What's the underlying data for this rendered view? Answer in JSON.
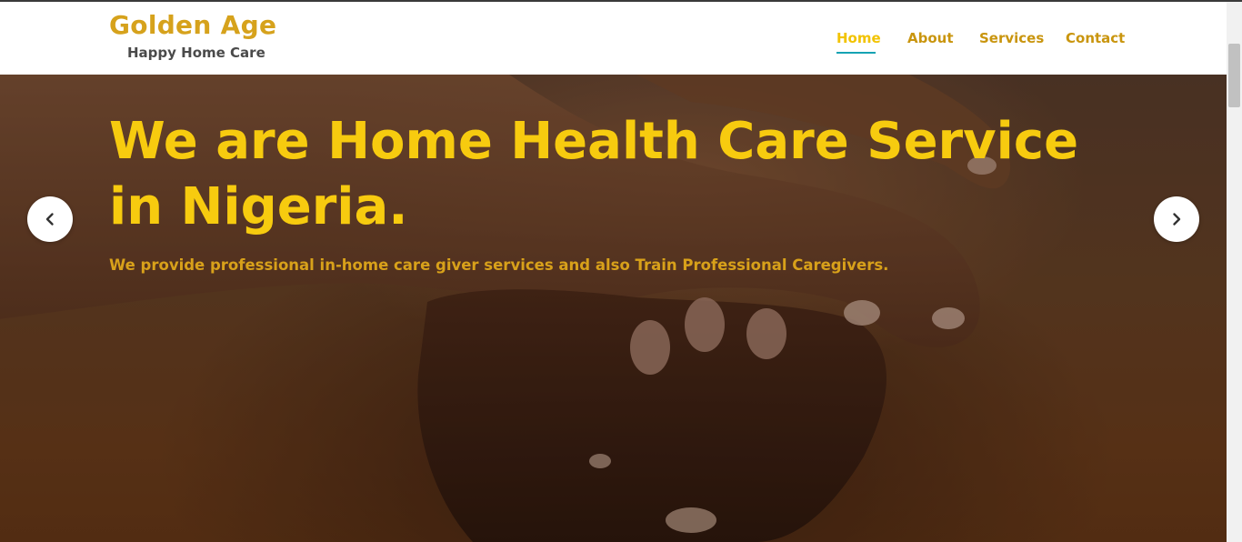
{
  "brand": {
    "name": "Golden Age",
    "tagline": "Happy Home Care"
  },
  "nav": {
    "items": [
      {
        "label": "Home",
        "active": true
      },
      {
        "label": "About",
        "active": false
      },
      {
        "label": "Services",
        "active": false
      },
      {
        "label": "Contact",
        "active": false
      }
    ]
  },
  "hero": {
    "title": "We are Home Health Care Service in Nigeria.",
    "subtitle": "We provide professional in-home care giver services and also Train Professional Caregivers.",
    "image": "holding-hands-photo",
    "prev_icon": "chevron-left-icon",
    "next_icon": "chevron-right-icon"
  },
  "colors": {
    "brand_gold": "#d6a21c",
    "nav_link": "#c9950e",
    "nav_active": "#f2c300",
    "nav_underline": "#16a3b3",
    "hero_title": "#f7cb0f",
    "hero_subtitle": "#d8a11a"
  }
}
